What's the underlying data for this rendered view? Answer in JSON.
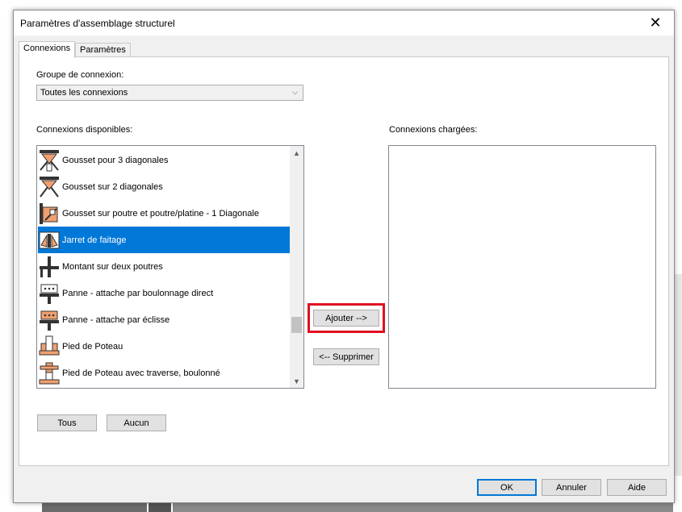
{
  "dialog": {
    "title": "Paramètres d'assemblage structurel",
    "close_glyph": "✕"
  },
  "tabs": [
    {
      "label": "Connexions",
      "active": true
    },
    {
      "label": "Paramètres",
      "active": false
    }
  ],
  "group": {
    "label": "Groupe de connexion:",
    "selected": "Toutes les connexions"
  },
  "available": {
    "label": "Connexions disponibles:",
    "items": [
      {
        "label": "Gousset pour 3 diagonales",
        "icon": "gusset-3-diagonals-icon",
        "selected": false
      },
      {
        "label": "Gousset sur 2 diagonales",
        "icon": "gusset-2-diagonals-icon",
        "selected": false
      },
      {
        "label": "Gousset sur poutre et poutre/platine - 1 Diagonale",
        "icon": "gusset-beam-plate-icon",
        "selected": false
      },
      {
        "label": "Jarret de faitage",
        "icon": "apex-haunch-icon",
        "selected": true
      },
      {
        "label": "Montant sur deux poutres",
        "icon": "post-on-beams-icon",
        "selected": false
      },
      {
        "label": "Panne - attache par boulonnage direct",
        "icon": "purlin-direct-bolt-icon",
        "selected": false
      },
      {
        "label": "Panne - attache par éclisse",
        "icon": "purlin-splice-icon",
        "selected": false
      },
      {
        "label": "Pied de Poteau",
        "icon": "column-base-icon",
        "selected": false
      },
      {
        "label": "Pied de Poteau avec traverse, boulonné",
        "icon": "column-base-crossbar-icon",
        "selected": false
      }
    ]
  },
  "loaded": {
    "label": "Connexions chargées:",
    "items": []
  },
  "buttons": {
    "add": "Ajouter -->",
    "remove": "<-- Supprimer",
    "all": "Tous",
    "none": "Aucun",
    "ok": "OK",
    "cancel": "Annuler",
    "help": "Aide"
  },
  "colors": {
    "selection": "#0078d7",
    "highlight_box": "#e0101f",
    "icon_orange": "#f0a070"
  }
}
